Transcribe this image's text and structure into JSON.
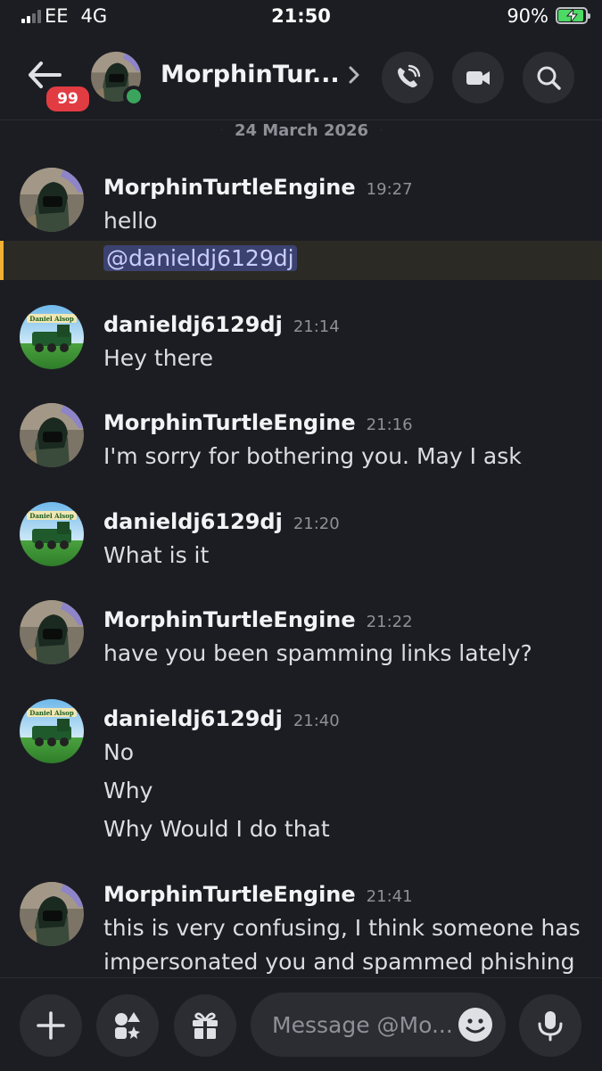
{
  "status_bar": {
    "carrier": "EE",
    "network": "4G",
    "time": "21:50",
    "battery": "90%",
    "battery_level": 0.9,
    "signal_bars": 2
  },
  "header": {
    "unread_badge": "99",
    "title": "MorphinTur...",
    "status": "online"
  },
  "date_divider": "24 March 2026",
  "messages": [
    {
      "author": "MorphinTurtleEngine",
      "time": "19:27",
      "lines": [
        "hello"
      ],
      "mention": "@danieldj6129dj",
      "avatar": "helmet-avatar"
    },
    {
      "author": "danieldj6129dj",
      "time": "21:14",
      "lines": [
        "Hey there"
      ],
      "avatar": "train-avatar",
      "avatar_text": "Daniel Alsop"
    },
    {
      "author": "MorphinTurtleEngine",
      "time": "21:16",
      "lines": [
        "I'm sorry for bothering you. May I ask"
      ],
      "avatar": "helmet-avatar"
    },
    {
      "author": "danieldj6129dj",
      "time": "21:20",
      "lines": [
        "What is it"
      ],
      "avatar": "train-avatar"
    },
    {
      "author": "MorphinTurtleEngine",
      "time": "21:22",
      "lines": [
        "have you been spamming links lately?"
      ],
      "avatar": "helmet-avatar"
    },
    {
      "author": "danieldj6129dj",
      "time": "21:40",
      "lines": [
        "No",
        "Why",
        "Why Would I do that"
      ],
      "avatar": "train-avatar"
    },
    {
      "author": "MorphinTurtleEngine",
      "time": "21:41",
      "lines": [
        "this is very confusing, I think someone has",
        "impersonated you and spammed phishing"
      ],
      "avatar": "helmet-avatar"
    }
  ],
  "composer": {
    "placeholder": "Message @Mo..."
  },
  "colors": {
    "background": "#1c1d22",
    "badge": "#e23c43",
    "online": "#3ba55d",
    "mention_bar": "#f0b232",
    "mention_text": "#c9cdfb"
  },
  "icons": [
    "back-arrow-icon",
    "chevron-right-icon",
    "voice-call-icon",
    "video-call-icon",
    "search-icon",
    "plus-icon",
    "apps-icon",
    "gift-icon",
    "emoji-icon",
    "microphone-icon"
  ]
}
